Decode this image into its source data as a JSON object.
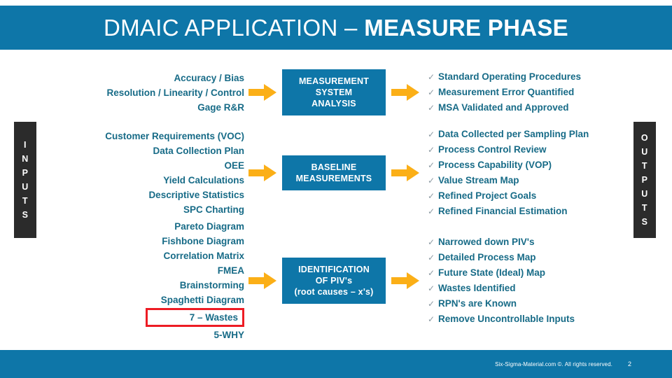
{
  "title": {
    "light_part": "DMAIC APPLICATION – ",
    "bold_part": "MEASURE PHASE",
    "banner_color": "#0E76A8"
  },
  "rails": {
    "left": {
      "name": "INPUTS",
      "letters": [
        "I",
        "N",
        "P",
        "U",
        "T",
        "S"
      ],
      "color": "#2B2B2B"
    },
    "right": {
      "name": "OUTPUTS",
      "letters": [
        "O",
        "U",
        "T",
        "P",
        "U",
        "T",
        "S"
      ],
      "color": "#2B2B2B"
    }
  },
  "accent": {
    "text_teal": "#176B87",
    "box_blue": "#0E76A8",
    "arrow_orange": "#FBAF17",
    "highlight_red": "#ED1C24",
    "check_gray": "#8C9AA3"
  },
  "rows": [
    {
      "inputs": [
        "Accuracy / Bias",
        "Resolution / Linearity / Control",
        "Gage R&R"
      ],
      "process": [
        "MEASUREMENT",
        "SYSTEM",
        "ANALYSIS"
      ],
      "outputs": [
        "Standard Operating Procedures",
        "Measurement Error Quantified",
        "MSA Validated and Approved"
      ]
    },
    {
      "inputs": [
        "Customer Requirements (VOC)",
        "Data Collection Plan",
        "OEE",
        "Yield Calculations",
        "Descriptive Statistics",
        "SPC Charting"
      ],
      "process": [
        "BASELINE",
        "MEASUREMENTS"
      ],
      "outputs": [
        "Data Collected per Sampling Plan",
        "Process Control Review",
        "Process Capability (VOP)",
        "Value Stream Map",
        "Refined Project Goals",
        "Refined Financial Estimation"
      ]
    },
    {
      "inputs": [
        "Pareto Diagram",
        "Fishbone Diagram",
        "Correlation Matrix",
        "FMEA",
        "Brainstorming",
        "Spaghetti Diagram",
        "7 – Wastes",
        "5-WHY"
      ],
      "highlighted_input": "7 – Wastes",
      "process": [
        "IDENTIFICATION",
        "OF PIV's",
        "(root causes – x's)"
      ],
      "outputs": [
        "Narrowed down PIV's",
        "Detailed Process Map",
        "Future State (Ideal) Map",
        "Wastes Identified",
        "RPN's are Known",
        "Remove Uncontrollable Inputs"
      ]
    }
  ],
  "icons": {
    "check": "✓",
    "arrow": "right-arrow-icon"
  },
  "footer": {
    "copyright": "Six-Sigma-Material.com ©. All rights reserved.",
    "page_number": "2",
    "color": "#0E76A8"
  }
}
